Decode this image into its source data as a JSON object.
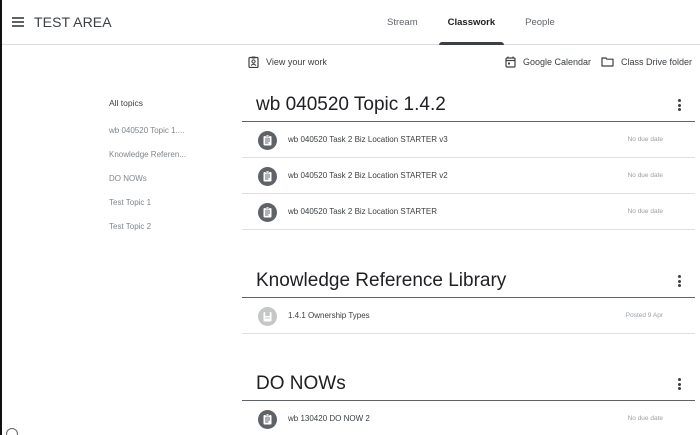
{
  "header": {
    "title": "TEST AREA",
    "tabs": [
      {
        "label": "Stream",
        "active": false
      },
      {
        "label": "Classwork",
        "active": true
      },
      {
        "label": "People",
        "active": false
      }
    ]
  },
  "toolbar": {
    "view_work": "View your work",
    "google_calendar": "Google Calendar",
    "drive_folder": "Class Drive folder"
  },
  "sidebar": {
    "items": [
      {
        "label": "All topics"
      },
      {
        "label": "wb 040520 Topic 1...."
      },
      {
        "label": "Knowledge Referen..."
      },
      {
        "label": "DO NOWs"
      },
      {
        "label": "Test Topic 1"
      },
      {
        "label": "Test Topic 2"
      }
    ]
  },
  "sections": [
    {
      "title": "wb 040520 Topic 1.4.2",
      "items": [
        {
          "title": "wb 040520 Task 2 Biz Location STARTER v3",
          "meta": "No due date",
          "icon": "assignment-icon"
        },
        {
          "title": "wb 040520 Task 2 Biz Location STARTER v2",
          "meta": "No due date",
          "icon": "assignment-icon"
        },
        {
          "title": "wb 040520 Task 2 Biz Location STARTER",
          "meta": "No due date",
          "icon": "assignment-icon"
        }
      ]
    },
    {
      "title": "Knowledge Reference Library",
      "items": [
        {
          "title": "1.4.1 Ownership Types",
          "meta": "Posted 9 Apr",
          "icon": "material-icon"
        }
      ]
    },
    {
      "title": "DO NOWs",
      "items": [
        {
          "title": "wb 130420 DO NOW 2",
          "meta": "No due date",
          "icon": "assignment-icon"
        }
      ]
    }
  ],
  "colors": {
    "text": "#202124",
    "muted": "#80868b",
    "icon_dark": "#5f6368",
    "icon_light": "#c4c7c5"
  }
}
